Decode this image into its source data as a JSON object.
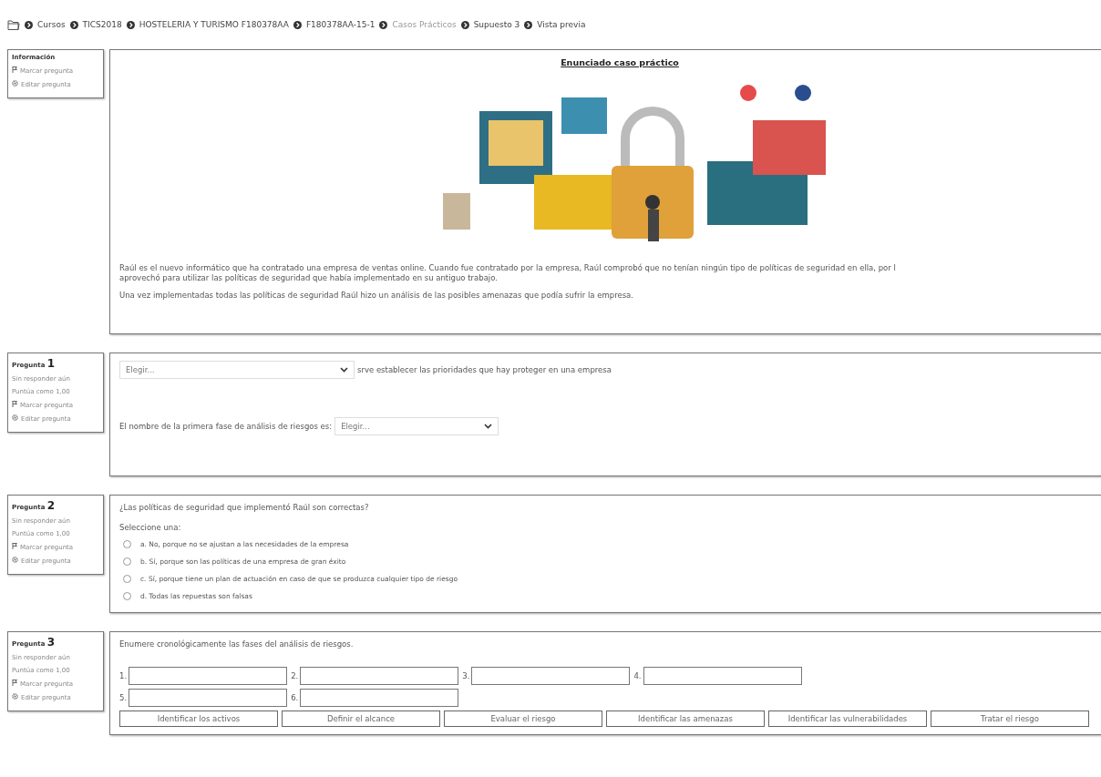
{
  "breadcrumb": [
    {
      "label": "Cursos",
      "disabled": false
    },
    {
      "label": "TICS2018",
      "disabled": false
    },
    {
      "label": "HOSTELERIA Y TURISMO F180378AA",
      "disabled": false
    },
    {
      "label": "F180378AA-15-1",
      "disabled": false
    },
    {
      "label": "Casos Prácticos",
      "disabled": true
    },
    {
      "label": "Supuesto 3",
      "disabled": false
    },
    {
      "label": "Vista previa",
      "disabled": false
    }
  ],
  "info": {
    "title": "Información",
    "flag": "Marcar pregunta",
    "edit": "Editar pregunta",
    "heading": "Enunciado caso práctico",
    "paragraphs": [
      "Raúl es el nuevo informático que ha contratado una empresa de ventas online. Cuando fue contratado por la empresa, Raúl comprobó que no tenían ningún tipo de políticas de seguridad en ella, por l",
      "aprovechó para utilizar las políticas de seguridad que había implementado en su antiguo trabajo.",
      "Una vez implementadas todas las políticas de seguridad Raúl hizo un análisis de las posibles amenazas que podía sufrir la empresa."
    ]
  },
  "questions": [
    {
      "kind": "select",
      "label": "Pregunta",
      "number": "1",
      "status": "Sin responder aún",
      "score": "Puntúa como 1,00",
      "flag": "Marcar pregunta",
      "edit": "Editar pregunta",
      "items": [
        {
          "select": "Elegir...",
          "after": "srve establecer las prioridades que hay proteger en una empresa"
        },
        {
          "before": "El nombre de la primera fase de análisis de riesgos es:",
          "select": "Elegir..."
        }
      ]
    },
    {
      "kind": "choice",
      "label": "Pregunta",
      "number": "2",
      "status": "Sin responder aún",
      "score": "Puntúa como 1,00",
      "flag": "Marcar pregunta",
      "edit": "Editar pregunta",
      "prompt": "¿Las políticas de seguridad que implementó Raúl son correctas?",
      "instruction": "Seleccione una:",
      "options": [
        {
          "text": "a. No, porque no se ajustan a las necesidades de la empresa",
          "selected": false
        },
        {
          "text": "b. Sí, porque son las políticas de una empresa de gran éxito",
          "selected": false
        },
        {
          "text": "c. Sí, porque tiene un plan de actuación en caso de que se produzca cualquier tipo de riesgo",
          "selected": false
        },
        {
          "text": "d. Todas las repuestas son falsas",
          "selected": false
        }
      ]
    },
    {
      "kind": "order",
      "label": "Pregunta",
      "number": "3",
      "status": "Sin responder aún",
      "score": "Puntúa como 1,00",
      "flag": "Marcar pregunta",
      "edit": "Editar pregunta",
      "prompt": "Enumere cronológicamente las fases del análisis de riesgos.",
      "slots": [
        "1.",
        "2.",
        "3.",
        "4.",
        "5.",
        "6."
      ],
      "choices": [
        "Identificar los activos",
        "Definir el alcance",
        "Evaluar el riesgo",
        "Identificar las amenazas",
        "Identificar las vulnerabilidades",
        "Tratar el riesgo"
      ]
    }
  ]
}
